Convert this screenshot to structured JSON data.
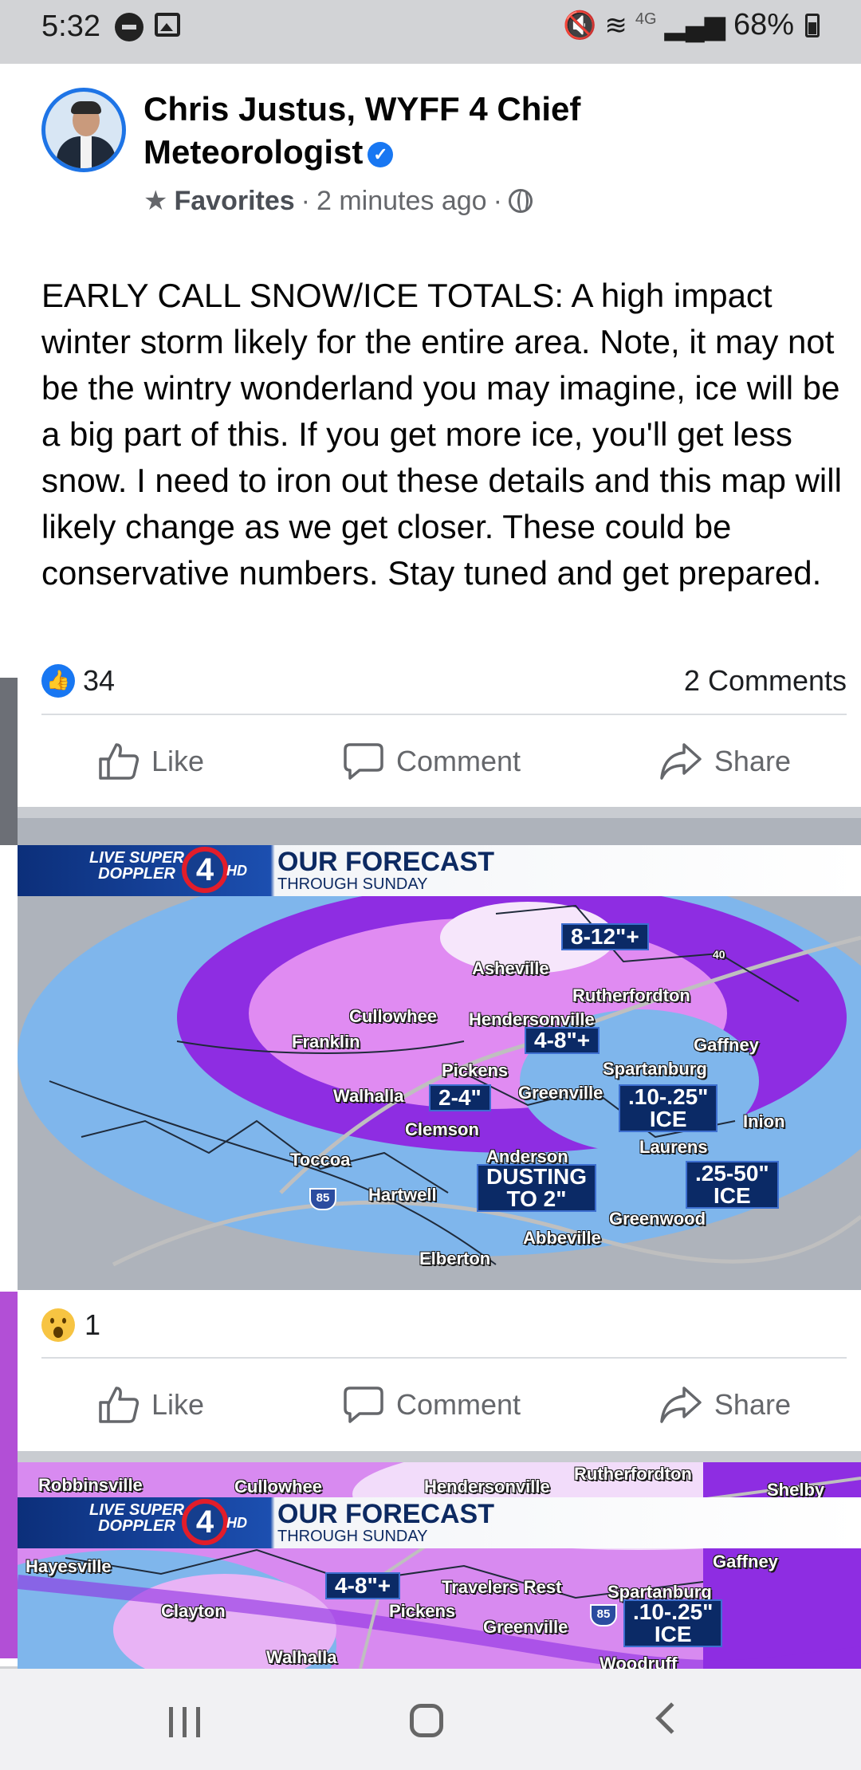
{
  "status_bar": {
    "time": "5:32",
    "network": "4G",
    "battery": "68%"
  },
  "post": {
    "author": "Chris Justus, WYFF 4 Chief Meteorologist",
    "favorites_label": "Favorites",
    "time_ago": "2 minutes ago",
    "text": "EARLY CALL SNOW/ICE TOTALS: A high impact winter storm likely for the entire area. Note, it may not be the wintry wonderland you may imagine, ice will be a big part of this. If you get more ice, you'll get less snow. I need to iron out these details and this map will likely change as we get closer. These could be conservative numbers. Stay tuned and get prepared.",
    "like_count": "34",
    "comments_count": "2 Comments",
    "actions": {
      "like": "Like",
      "comment": "Comment",
      "share": "Share"
    }
  },
  "map1": {
    "banner": {
      "brand_line1": "LIVE SUPER",
      "brand_line2": "DOPPLER",
      "brand_hd": "HD",
      "channel": "4",
      "title": "OUR FORECAST",
      "subtitle": "THROUGH SUNDAY"
    },
    "places": {
      "asheville": "Asheville",
      "rutherfordton": "Rutherfordton",
      "cullowhee": "Cullowhee",
      "hendersonville": "Hendersonville",
      "franklin": "Franklin",
      "gaffney": "Gaffney",
      "pickens": "Pickens",
      "spartanburg": "Spartanburg",
      "walhalla": "Walhalla",
      "greenville": "Greenville",
      "clemson": "Clemson",
      "union": "Inion",
      "laurens": "Laurens",
      "toccoa": "Toccoa",
      "anderson": "Anderson",
      "hartwell": "Hartwell",
      "greenwood": "Greenwood",
      "abbeville": "Abbeville",
      "elberton": "Elberton",
      "i85": "85",
      "i40": "40"
    },
    "amounts": {
      "a1": "8-12\"+",
      "a2": "4-8\"+",
      "a3": "2-4\"",
      "a4_line1": ".10-.25\"",
      "a4_line2": "ICE",
      "a5_line1": "DUSTING",
      "a5_line2": "TO 2\"",
      "a6_line1": ".25-50\"",
      "a6_line2": "ICE"
    }
  },
  "map1_reactions": {
    "wow_count": "1"
  },
  "map2": {
    "banner": {
      "brand_line1": "LIVE SUPER",
      "brand_line2": "DOPPLER",
      "brand_hd": "HD",
      "channel": "4",
      "title": "OUR FORECAST",
      "subtitle": "THROUGH SUNDAY"
    },
    "places": {
      "robbinsville": "Robbinsville",
      "cullowhee": "Cullowhee",
      "hendersonville": "Hendersonville",
      "rutherfordton": "Rutherfordton",
      "shelby": "Shelby",
      "hayesville": "Hayesville",
      "gaffney": "Gaffney",
      "travelers_rest": "Travelers Rest",
      "clayton": "Clayton",
      "pickens": "Pickens",
      "spartanburg": "Spartanburg",
      "greenville": "Greenville",
      "walhalla": "Walhalla",
      "woodruff": "Woodruff",
      "i85": "85"
    },
    "amounts": {
      "a1": "4-8\"+",
      "a2_line1": ".10-.25\"",
      "a2_line2": "ICE"
    }
  },
  "colors": {
    "facebook_blue": "#1877f2",
    "snow_purple": "#8e2de2",
    "snow_pink": "#e08bf2",
    "ice_blue": "#7fb6ec"
  }
}
